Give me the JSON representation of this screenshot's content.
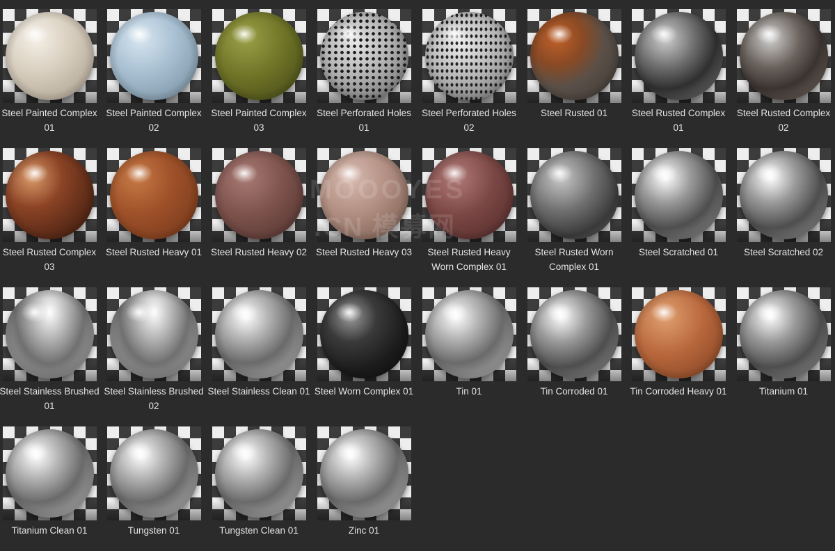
{
  "materials": [
    {
      "label": "Steel Painted Complex 01",
      "finish": "painted-cream",
      "color": "#d9cfc0"
    },
    {
      "label": "Steel Painted Complex 02",
      "finish": "painted-light-blue",
      "color": "#a9c1d3"
    },
    {
      "label": "Steel Painted Complex 03",
      "finish": "painted-olive",
      "color": "#6f7427"
    },
    {
      "label": "Steel Perforated Holes 01",
      "finish": "perforated-round-holes",
      "color": "#a9a9a9"
    },
    {
      "label": "Steel Perforated Holes 02",
      "finish": "perforated-oval-holes",
      "color": "#b0b0b0"
    },
    {
      "label": "Steel Rusted 01",
      "finish": "rusted-orange-patches",
      "color": "#8a4a24"
    },
    {
      "label": "Steel Rusted Complex 01",
      "finish": "dark-chrome",
      "color": "#6d6d6d"
    },
    {
      "label": "Steel Rusted Complex 02",
      "finish": "dark-chrome-rust-spots",
      "color": "#6a625c"
    },
    {
      "label": "Steel Rusted Complex 03",
      "finish": "glossy-rust",
      "color": "#8b4325"
    },
    {
      "label": "Steel Rusted Heavy 01",
      "finish": "heavy-rust-orange",
      "color": "#a0522a"
    },
    {
      "label": "Steel Rusted Heavy 02",
      "finish": "heavy-rust-maroon",
      "color": "#7d524c"
    },
    {
      "label": "Steel Rusted Heavy 03",
      "finish": "heavy-rust-pink",
      "color": "#b08d80"
    },
    {
      "label": "Steel Rusted Heavy Worn Complex 01",
      "finish": "worn-rust-red",
      "color": "#7b4745"
    },
    {
      "label": "Steel Rusted Worn Complex 01",
      "finish": "worn-grey-metal",
      "color": "#6f6f6f"
    },
    {
      "label": "Steel Scratched 01",
      "finish": "scratched-chrome",
      "color": "#9a9a9a"
    },
    {
      "label": "Steel Scratched 02",
      "finish": "scratched-chrome",
      "color": "#9a9a9a"
    },
    {
      "label": "Steel Stainless Brushed 01",
      "finish": "brushed-stainless",
      "color": "#bdbdbd"
    },
    {
      "label": "Steel Stainless Brushed 02",
      "finish": "brushed-stainless",
      "color": "#bdbdbd"
    },
    {
      "label": "Steel Stainless Clean 01",
      "finish": "clean-stainless",
      "color": "#b8b8b8"
    },
    {
      "label": "Steel Worn Complex 01",
      "finish": "worn-black-metal",
      "color": "#3a3a3a"
    },
    {
      "label": "Tin 01",
      "finish": "tin",
      "color": "#b8b8b8"
    },
    {
      "label": "Tin Corroded 01",
      "finish": "corroded-tin",
      "color": "#9a9a9a"
    },
    {
      "label": "Tin Corroded Heavy 01",
      "finish": "copper-orange",
      "color": "#b8673c"
    },
    {
      "label": "Titanium 01",
      "finish": "titanium",
      "color": "#9a9a9a"
    },
    {
      "label": "Titanium Clean 01",
      "finish": "clean-mirror",
      "color": "#b8b8b8"
    },
    {
      "label": "Tungsten 01",
      "finish": "tungsten",
      "color": "#b8b8b8"
    },
    {
      "label": "Tungsten Clean 01",
      "finish": "clean-mirror",
      "color": "#b8b8b8"
    },
    {
      "label": "Zinc 01",
      "finish": "zinc",
      "color": "#b8b8b8"
    }
  ],
  "watermark": {
    "line1": "MOOOYES",
    "line2": ".CN 模募网"
  }
}
